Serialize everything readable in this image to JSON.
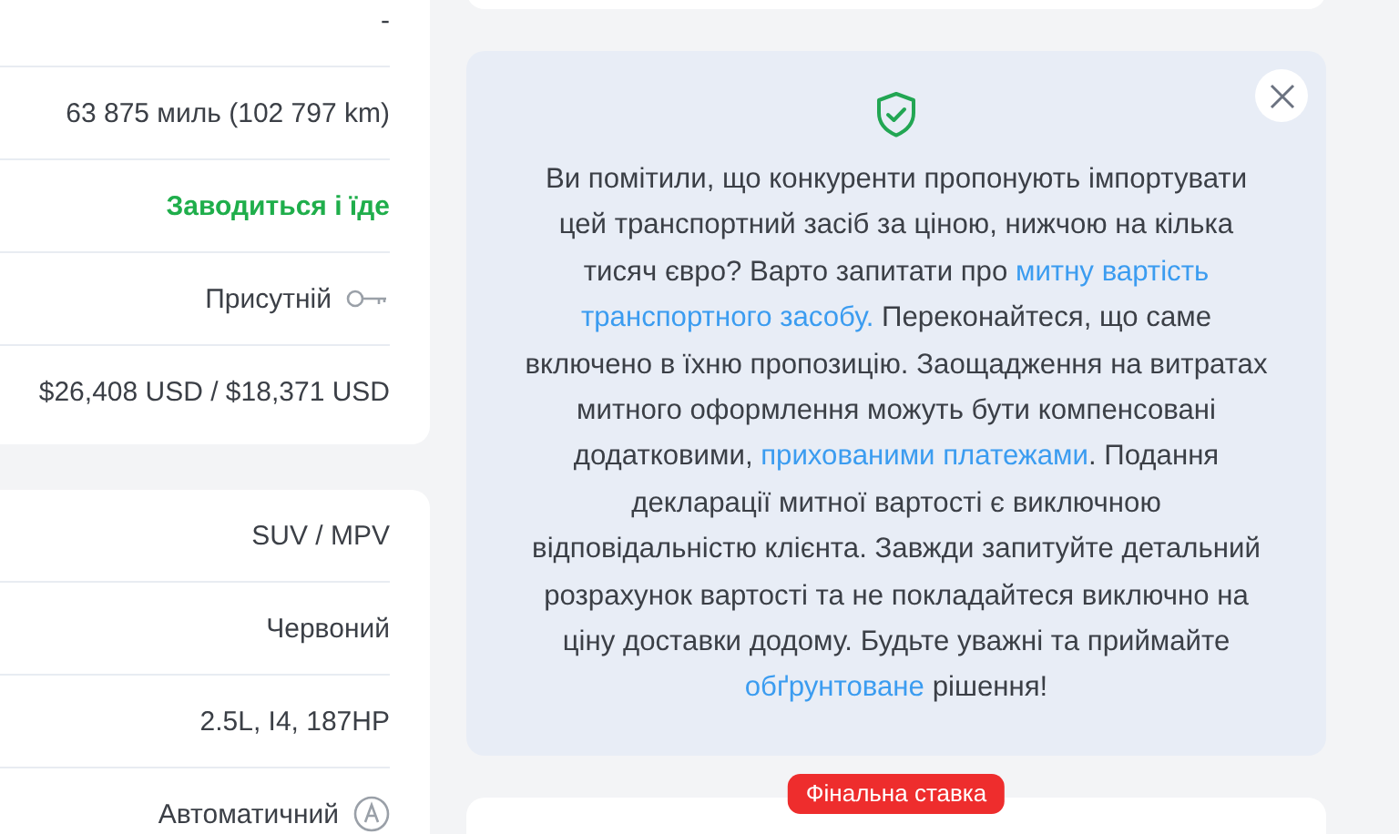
{
  "specs_card": {
    "rows": [
      {
        "kind": "text",
        "value": "-"
      },
      {
        "kind": "text",
        "value": "63 875 миль (102 797 km)"
      },
      {
        "kind": "status",
        "value": "Заводиться і їде"
      },
      {
        "kind": "key",
        "value": "Присутній"
      },
      {
        "kind": "text",
        "value": "$26,408 USD / $18,371 USD"
      }
    ]
  },
  "details_card": {
    "rows": [
      {
        "kind": "text",
        "value": "SUV / MPV"
      },
      {
        "kind": "text",
        "value": "Червоний"
      },
      {
        "kind": "text",
        "value": "2.5L, I4, 187HP"
      },
      {
        "kind": "transmission",
        "value": "Автоматичний"
      }
    ]
  },
  "notice": {
    "segments": [
      {
        "kind": "text",
        "text": "Ви помітили, що конкуренти пропонують імпортувати цей транспортний засіб за ціною, нижчою на кілька тисяч євро? Варто запитати про "
      },
      {
        "kind": "link",
        "lines": [
          "митну вартість",
          "транспортного засобу."
        ]
      },
      {
        "kind": "text",
        "text": " Переконайтеся, що саме включено в їхню пропозицію. Заощадження на витратах митного оформлення можуть бути компенсовані додатковими, "
      },
      {
        "kind": "link",
        "text": "прихованими платежами"
      },
      {
        "kind": "text",
        "text": ". Подання декларації митної вартості є виключною відповідальністю клієнта. Завжди запитуйте детальний розрахунок вартості та не покладайтеся виключно на ціну доставки додому. Будьте уважні та приймайте "
      },
      {
        "kind": "link",
        "text": "обґрунтоване"
      },
      {
        "kind": "text",
        "text": " рішення!"
      }
    ]
  },
  "bid_card": {
    "badge": "Фінальна ставка"
  }
}
